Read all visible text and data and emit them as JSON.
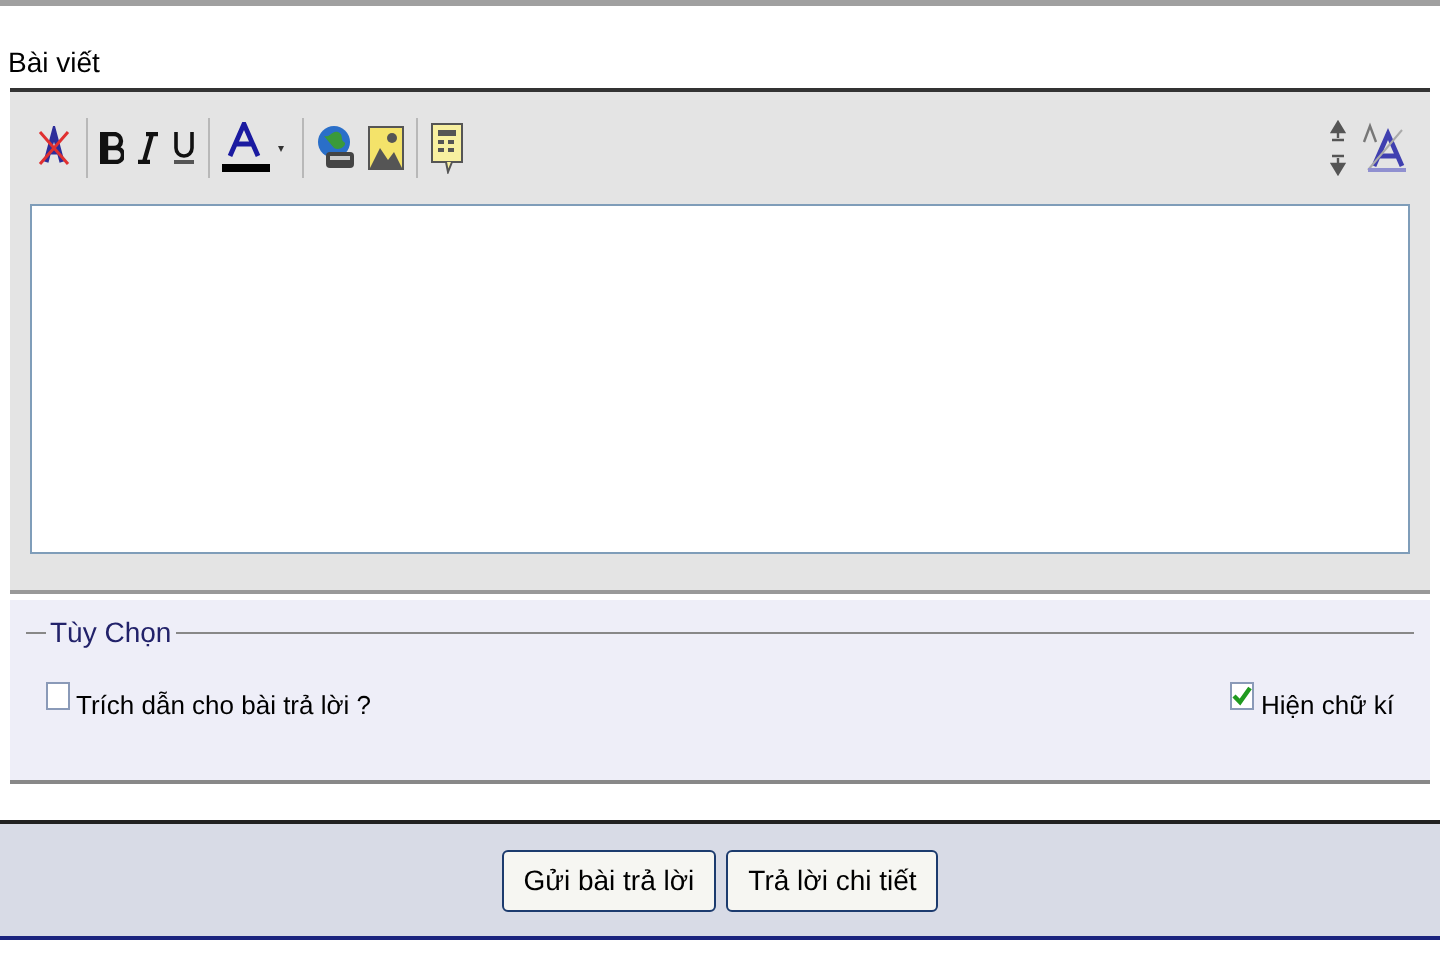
{
  "post_label": "Bài viết",
  "toolbar": {
    "left": [
      {
        "kind": "remove-format"
      },
      {
        "kind": "sep"
      },
      {
        "kind": "bold"
      },
      {
        "kind": "italic"
      },
      {
        "kind": "underline"
      },
      {
        "kind": "sep"
      },
      {
        "kind": "font-color"
      },
      {
        "kind": "sep"
      },
      {
        "kind": "link"
      },
      {
        "kind": "image"
      },
      {
        "kind": "sep"
      },
      {
        "kind": "note"
      }
    ],
    "right": [
      {
        "kind": "resize"
      },
      {
        "kind": "font-size"
      }
    ]
  },
  "options": {
    "legend": "Tùy Chọn",
    "items": [
      {
        "label": "Trích dẫn cho bài trả lời ?",
        "checked": false
      },
      {
        "label": "Hiện chữ kí",
        "checked": true
      }
    ]
  },
  "buttons": [
    "Gửi bài trả lời",
    "Trả lời chi tiết"
  ]
}
